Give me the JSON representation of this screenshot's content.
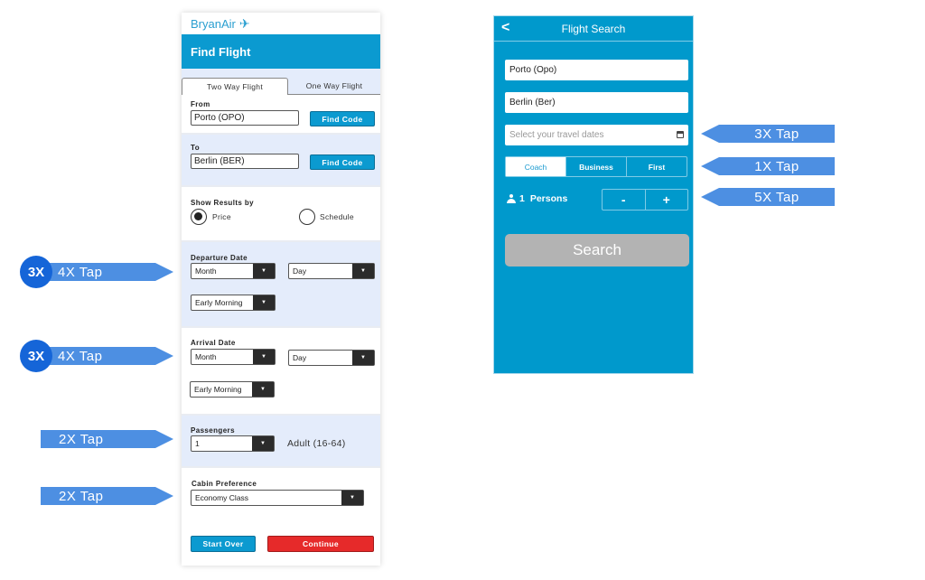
{
  "left_app": {
    "brand": "BryanAir",
    "brand_icon": "airplane-icon",
    "header_title": "Find Flight",
    "tabs": [
      {
        "label": "Two Way Flight",
        "active": true
      },
      {
        "label": "One Way Flight",
        "active": false
      }
    ],
    "from": {
      "label": "From",
      "value": "Porto (OPO)",
      "button": "Find Code"
    },
    "to": {
      "label": "To",
      "value": "Berlin (BER)",
      "button": "Find Code"
    },
    "show_results": {
      "label": "Show Results by",
      "options": [
        {
          "label": "Price",
          "selected": true
        },
        {
          "label": "Schedule",
          "selected": false
        }
      ]
    },
    "departure": {
      "label": "Departure Date",
      "month": "Month",
      "day": "Day",
      "time": "Early Morning"
    },
    "arrival": {
      "label": "Arrival Date",
      "month": "Month",
      "day": "Day",
      "time": "Early Morning"
    },
    "passengers": {
      "label": "Passengers",
      "value": "1",
      "note": "Adult (16-64)"
    },
    "cabin": {
      "label": "Cabin Preference",
      "value": "Economy Class"
    },
    "buttons": {
      "start_over": "Start Over",
      "continue": "Continue"
    },
    "colors": {
      "primary": "#0b9ad0",
      "continue": "#e62a2a",
      "section_alt": "#e4ecfb"
    }
  },
  "left_callouts": [
    {
      "badge": "3X",
      "label": "4X Tap"
    },
    {
      "badge": "3X",
      "label": "4X Tap"
    },
    {
      "label": "2X Tap"
    },
    {
      "label": "2X Tap"
    }
  ],
  "right_app": {
    "title": "Flight Search",
    "back_icon": "chevron-left-icon",
    "origin": "Porto (Opo)",
    "destination": "Berlin (Ber)",
    "dates_placeholder": "Select your travel dates",
    "cabin_classes": [
      {
        "label": "Coach",
        "selected": true
      },
      {
        "label": "Business",
        "selected": false
      },
      {
        "label": "First",
        "selected": false
      }
    ],
    "persons": {
      "count": "1",
      "label": "Persons"
    },
    "stepper": {
      "minus": "-",
      "plus": "+"
    },
    "search_label": "Search",
    "colors": {
      "background": "#0099cc",
      "search_disabled": "#b3b3b3"
    }
  },
  "right_callouts": [
    {
      "label": "3X Tap"
    },
    {
      "label": "1X Tap"
    },
    {
      "label": "5X Tap"
    }
  ],
  "callout_color": "#4d8fe2",
  "badge_color": "#1565d8"
}
